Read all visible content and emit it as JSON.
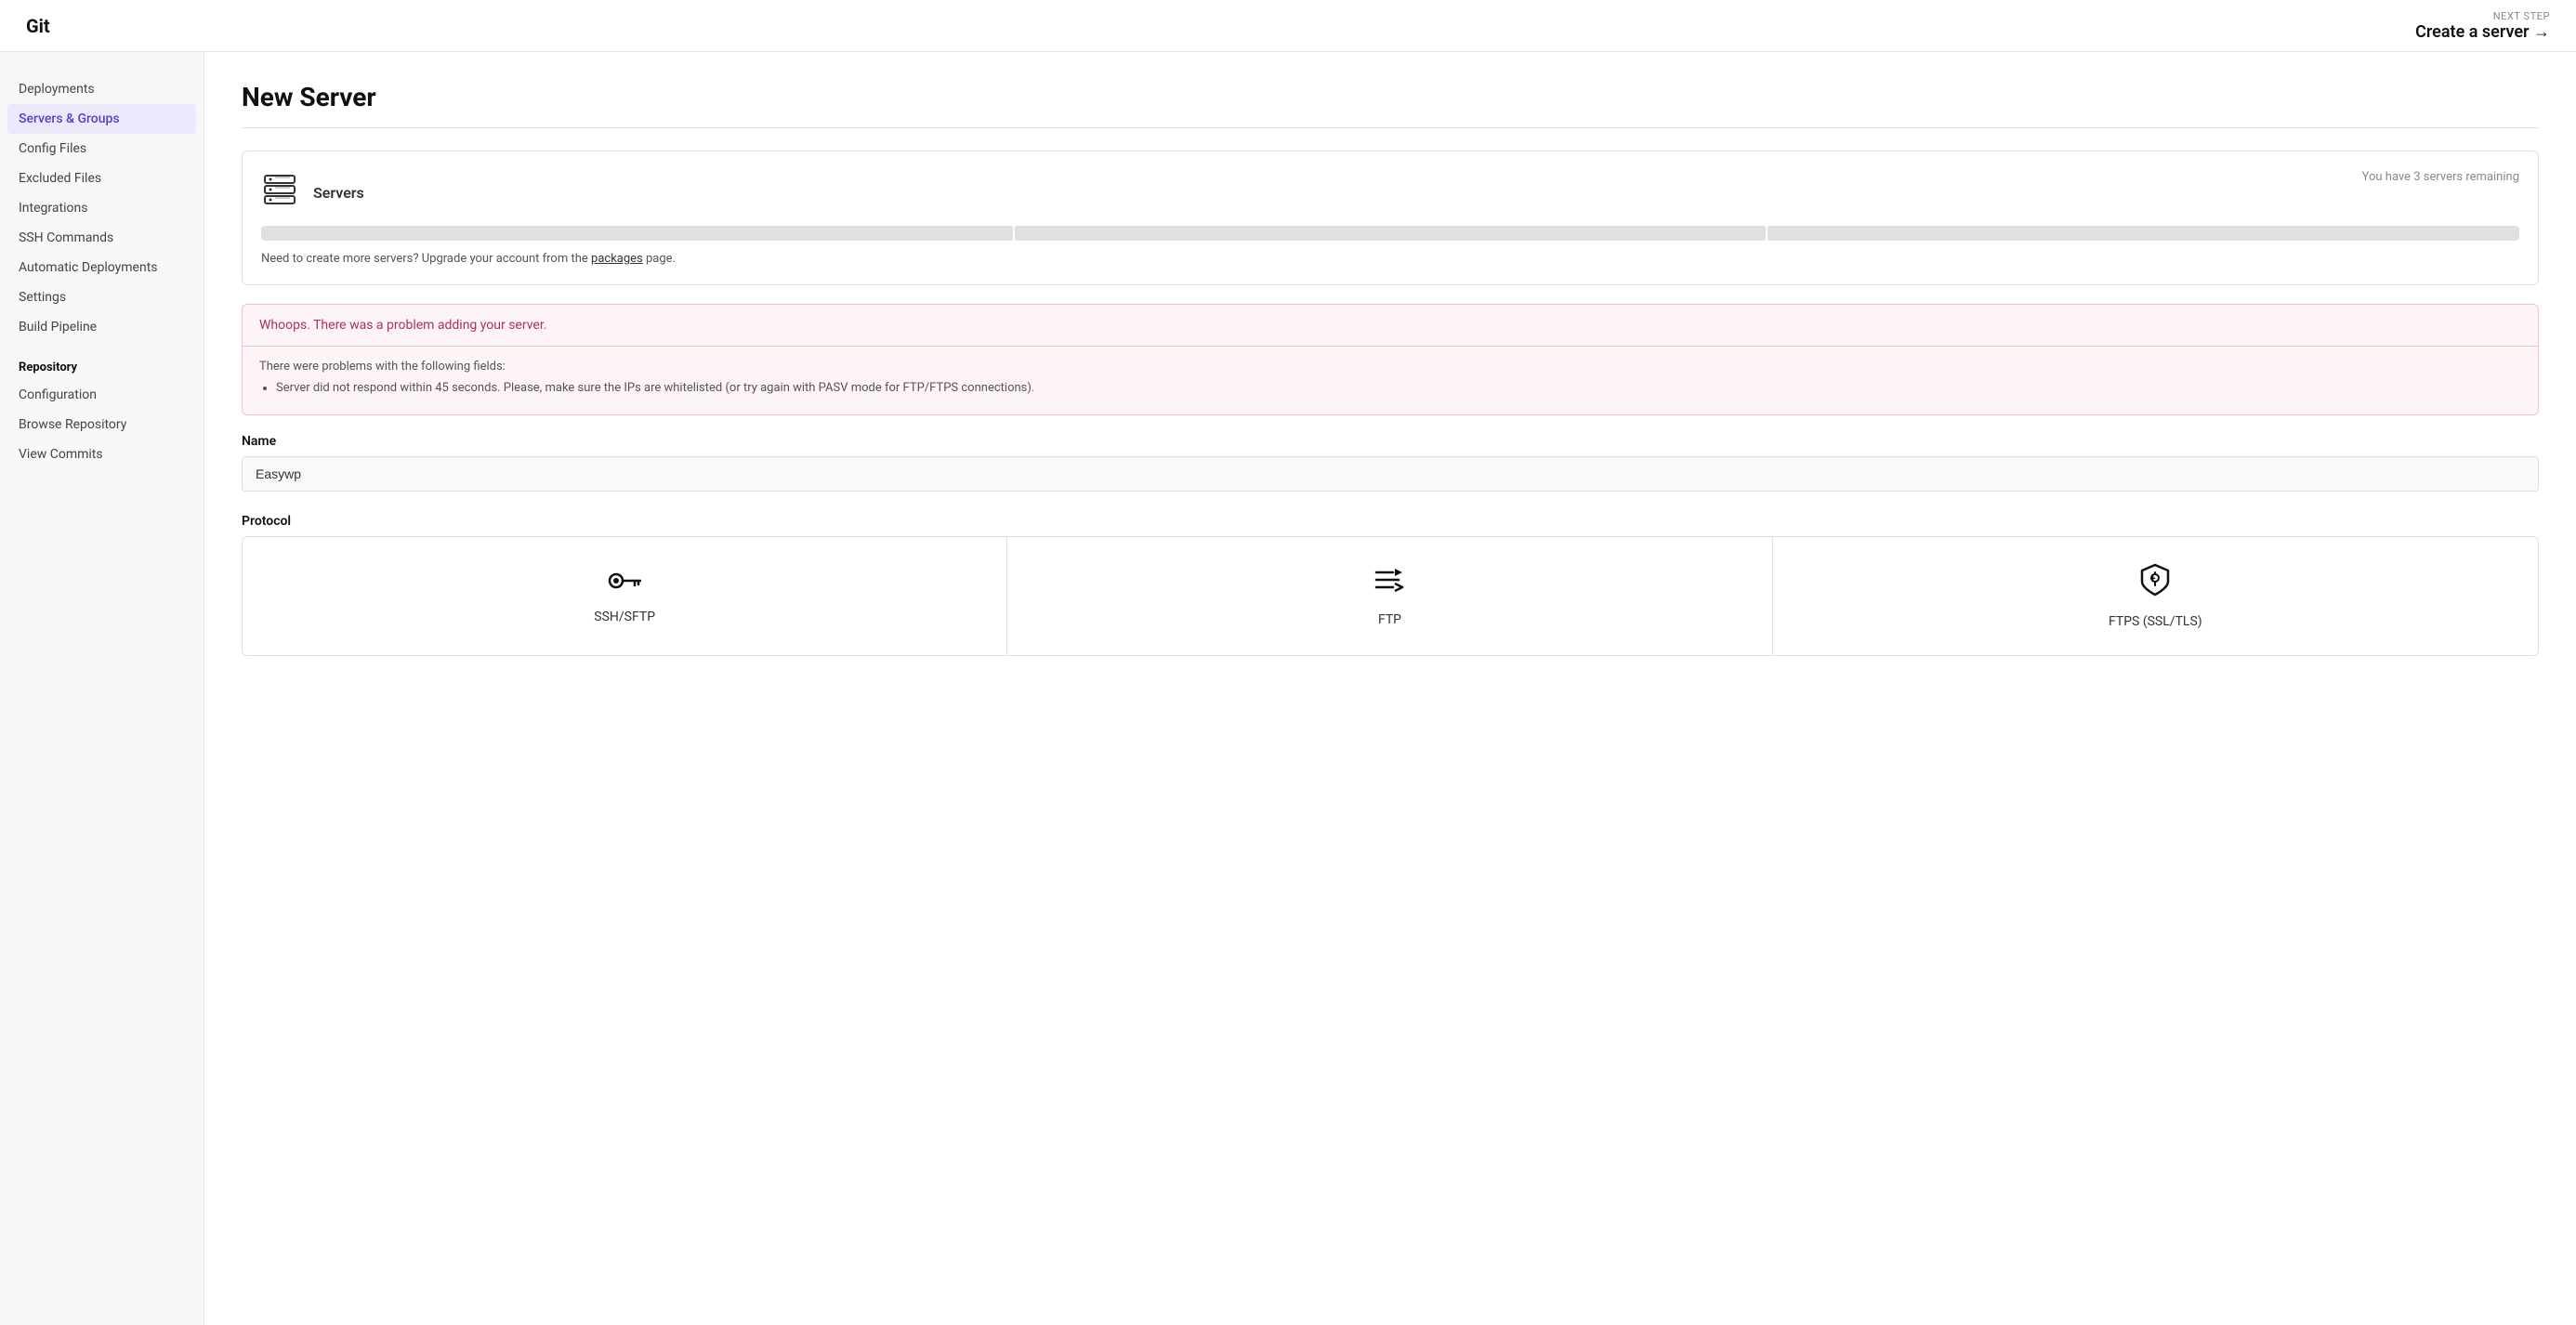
{
  "header": {
    "app_title": "Git",
    "next_step_label": "NEXT STEP",
    "next_step_text": "Create a server →"
  },
  "sidebar": {
    "nav_items": [
      {
        "id": "deployments",
        "label": "Deployments",
        "active": false
      },
      {
        "id": "servers-groups",
        "label": "Servers & Groups",
        "active": true
      },
      {
        "id": "config-files",
        "label": "Config Files",
        "active": false
      },
      {
        "id": "excluded-files",
        "label": "Excluded Files",
        "active": false
      },
      {
        "id": "integrations",
        "label": "Integrations",
        "active": false
      },
      {
        "id": "ssh-commands",
        "label": "SSH Commands",
        "active": false
      },
      {
        "id": "automatic-deployments",
        "label": "Automatic Deployments",
        "active": false
      },
      {
        "id": "settings",
        "label": "Settings",
        "active": false
      },
      {
        "id": "build-pipeline",
        "label": "Build Pipeline",
        "active": false
      }
    ],
    "repository_section": "Repository",
    "repository_items": [
      {
        "id": "configuration",
        "label": "Configuration",
        "active": false
      },
      {
        "id": "browse-repository",
        "label": "Browse Repository",
        "active": false
      },
      {
        "id": "view-commits",
        "label": "View Commits",
        "active": false
      }
    ]
  },
  "main": {
    "page_title": "New Server",
    "servers_card": {
      "title": "Servers",
      "remaining_text": "You have 3 servers remaining",
      "note": "Need to create more servers? Upgrade your account from the",
      "note_link": "packages",
      "note_suffix": "page.",
      "segments": [
        {
          "filled": false
        },
        {
          "filled": false
        },
        {
          "filled": false
        }
      ]
    },
    "error": {
      "header": "Whoops. There was a problem adding your server.",
      "fields_label": "There were problems with the following fields:",
      "error_items": [
        "Server did not respond within 45 seconds. Please, make sure the IPs are whitelisted (or try again with PASV mode for FTP/FTPS connections)."
      ]
    },
    "form": {
      "name_label": "Name",
      "name_value": "Easywp",
      "name_placeholder": "",
      "protocol_label": "Protocol",
      "protocol_options": [
        {
          "id": "ssh-sftp",
          "label": "SSH/SFTP",
          "icon": "key"
        },
        {
          "id": "ftp",
          "label": "FTP",
          "icon": "ftp"
        },
        {
          "id": "ftps",
          "label": "FTPS (SSL/TLS)",
          "icon": "shield"
        }
      ]
    }
  }
}
